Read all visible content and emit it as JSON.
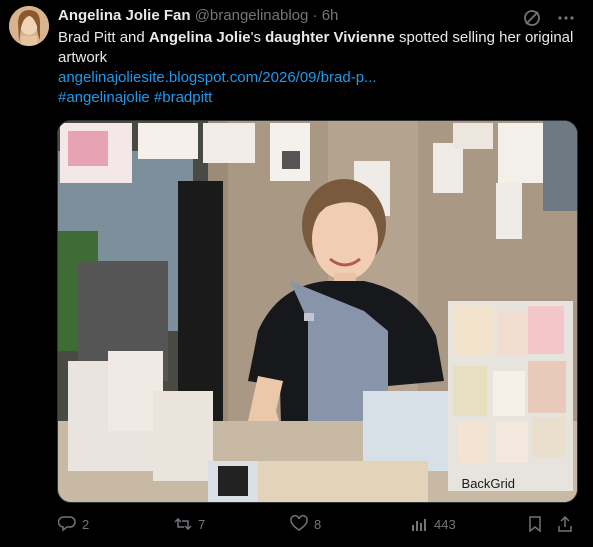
{
  "tweet": {
    "display_name": "Angelina Jolie Fan",
    "handle": "@brangelinablog",
    "separator": "·",
    "time": "6h",
    "text_parts": [
      "Brad Pitt and ",
      "Angelina Jolie",
      "'s ",
      "daughter Vivienne",
      " spotted selling her original artwork"
    ],
    "link": "angelinajoliesite.blogspot.com/2026/09/brad-p...",
    "hashtags": "#angelinajolie #bradpitt",
    "media_watermark": "BackGrid",
    "actions": {
      "reply_count": "2",
      "retweet_count": "7",
      "like_count": "8",
      "views_count": "443"
    },
    "icons": [
      "grok-icon",
      "more-icon",
      "reply-icon",
      "retweet-icon",
      "like-icon",
      "views-icon",
      "bookmark-icon",
      "share-icon"
    ],
    "colors": {
      "background": "#000000",
      "text": "#e7e9ea",
      "secondary": "#71767b",
      "link": "#1d9bf0"
    }
  }
}
